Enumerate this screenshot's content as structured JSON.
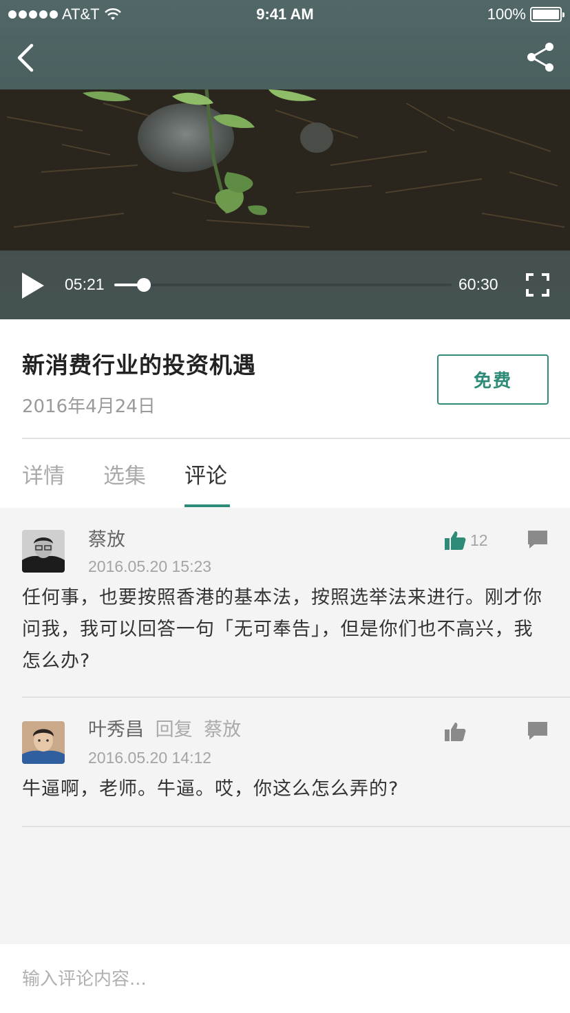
{
  "status_bar": {
    "carrier": "AT&T",
    "time": "9:41 AM",
    "battery": "100%"
  },
  "player": {
    "current_time": "05:21",
    "duration": "60:30",
    "progress": 0.088
  },
  "episode": {
    "title": "新消费行业的投资机遇",
    "date": "2016年4月24日",
    "price_label": "免费"
  },
  "tabs": [
    {
      "label": "详情",
      "active": false
    },
    {
      "label": "选集",
      "active": false
    },
    {
      "label": "评论",
      "active": true
    }
  ],
  "comments": [
    {
      "author": "蔡放",
      "reply_label": "",
      "reply_to": "",
      "time": "2016.05.20 15:23",
      "text": "任何事，也要按照香港的基本法，按照选举法来进行。刚才你问我，我可以回答一句「无可奉告」，但是你们也不高兴，我怎么办?",
      "likes": "12",
      "liked": true
    },
    {
      "author": "叶秀昌",
      "reply_label": "回复",
      "reply_to": "蔡放",
      "time": "2016.05.20 14:12",
      "text": "牛逼啊，老师。牛逼。哎，你这么怎么弄的?",
      "likes": "",
      "liked": false
    }
  ],
  "input": {
    "placeholder": "输入评论内容..."
  },
  "colors": {
    "accent": "#2e8b78",
    "liked": "#2e8b78",
    "muted_icon": "#8a8a8a"
  },
  "icons": {
    "back": "chevron-left-icon",
    "share": "share-icon",
    "play": "play-icon",
    "fullscreen": "fullscreen-icon",
    "like": "thumbs-up-icon",
    "reply": "chat-bubble-icon"
  }
}
